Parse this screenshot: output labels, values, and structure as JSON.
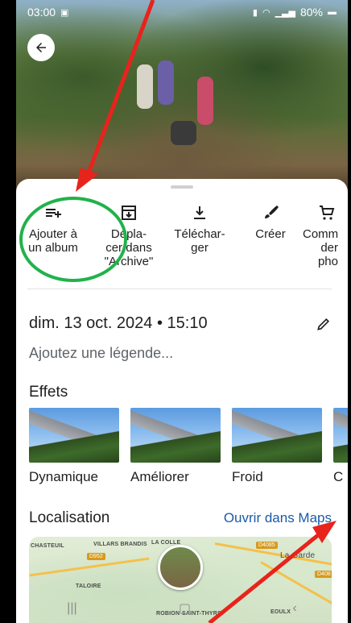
{
  "status_bar": {
    "time": "03:00",
    "battery": "80%"
  },
  "actions": [
    {
      "label": "Ajouter à\nun album",
      "icon": "playlist-add-icon"
    },
    {
      "label": "Dépla-\ncer dans\n\"Archive\"",
      "icon": "archive-icon"
    },
    {
      "label": "Téléchar-\nger",
      "icon": "download-icon"
    },
    {
      "label": "Créer",
      "icon": "brush-icon"
    },
    {
      "label": "Comm\nder\npho",
      "icon": "cart-icon"
    }
  ],
  "details": {
    "date": "dim. 13 oct. 2024 • 15:10",
    "caption_placeholder": "Ajoutez une légende..."
  },
  "effects": {
    "title": "Effets",
    "items": [
      {
        "label": "Dynamique"
      },
      {
        "label": "Améliorer"
      },
      {
        "label": "Froid"
      },
      {
        "label": "C"
      }
    ]
  },
  "location": {
    "title": "Localisation",
    "maps_link": "Ouvrir dans Maps",
    "map_labels": {
      "chasteuil": "CHASTEUIL",
      "villars": "VILLARS BRANDIS",
      "colle": "LA COLLE",
      "taloire": "TALOIRE",
      "robion": "ROBION",
      "saint_thyrs": "SAINT-THYRS",
      "eoulx": "EOULX",
      "la_garde": "La Garde"
    },
    "road_badges": {
      "d952": "D952",
      "d4085": "D4085",
      "d408": "D408"
    }
  },
  "colors": {
    "link": "#1a5aa8",
    "highlight": "#21b24b",
    "arrow": "#e8231c"
  }
}
